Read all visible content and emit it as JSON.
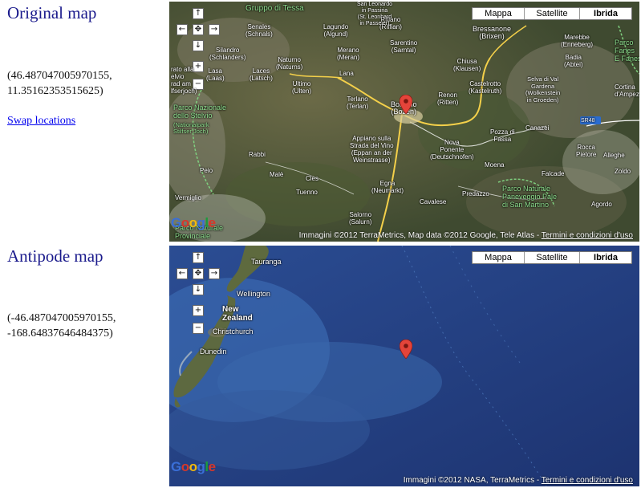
{
  "original": {
    "title": "Original map",
    "coords_line1": "(46.487047005970155,",
    "coords_line2": "11.35162353515625)",
    "swap_link": "Swap locations"
  },
  "antipode": {
    "title": "Antipode map",
    "coords_line1": "(-46.487047005970155,",
    "coords_line2": "-168.64837646484375)"
  },
  "map_controls": {
    "types": [
      "Mappa",
      "Satellite",
      "Ibrida"
    ],
    "selected": "Ibrida",
    "pan_up": "↑",
    "pan_left": "←",
    "pan_center": "✥",
    "pan_right": "→",
    "pan_down": "↓",
    "zoom_in": "+",
    "zoom_out": "−"
  },
  "original_map": {
    "labels": {
      "gruppo_tessa": "Gruppo di Tessa",
      "senales": "Senales\n(Schnals)",
      "lagundo": "Lagundo\n(Algund)",
      "rifiano": "Rifiano\n(Riffian)",
      "san_leonardo": "San Leonardo\nin Passiria\n(St. Leonhard\nin Passeier)",
      "sarentino": "Sarentino\n(Sarntal)",
      "bressanone": "Bressanone\n(Brixen)",
      "marebbe": "Marebbe\n(Enneberg)",
      "parco_fanes": "Parco\nFanes\nE Fanes",
      "silandro": "Silandro\n(Schlanders)",
      "naturno": "Naturno\n(Naturns)",
      "merano": "Merano\n(Meran)",
      "laces": "Laces\n(Latsch)",
      "lasa": "Lasa\n(Laas)",
      "prato": "rato alla\nelvio\nrad am\nlfserjoch)",
      "ultimo": "Ultimo\n(Ulten)",
      "lana": "Lana",
      "chiusa": "Chiusa\n(Klausen)",
      "badia": "Badia\n(Abtei)",
      "castelrotto": "Castelrotto\n(Kastelruth)",
      "selva": "Selva di Val\nGardena\n(Wolkenstein\nin Groeden)",
      "cortina": "Cortina\nd'Ampezz",
      "parco_stelvio": "Parco Nazionale\ndello Stelvio",
      "stelvio_sub": "(Nationalpark\nStilfser Joch)",
      "terlano": "Terlano\n(Terlan)",
      "bolzano": "Bolzano\n(Bozen)",
      "renon": "Renon\n(Ritten)",
      "sr48": "SR48",
      "appiano": "Appiano sulla\nStrada del Vino\n(Eppan an der\nWeinstrasse)",
      "nova_ponente": "Nova\nPonente\n(Deutschnofen)",
      "pozza": "Pozza di\nFassa",
      "canazei": "Canazei",
      "rabbi": "Rabbi",
      "rocca": "Rocca\nPietore",
      "alleghe": "Alleghe",
      "peio": "Peio",
      "male": "Malè",
      "cles": "Cles",
      "moena": "Moena",
      "falcade": "Falcade",
      "zoldo": "Zoldo",
      "vermiglio": "Vermiglio",
      "tuenno": "Tuenno",
      "egna": "Egna\n(Neumarkt)",
      "predazzo": "Predazzo",
      "parco_paneveggio": "Parco Naturale\nPaneveggio Pale\ndi San Martino",
      "cavalese": "Cavalese",
      "agordo": "Agordo",
      "salorno": "Salorno\n(Salurn)",
      "parco_adamello": "Parco Naturale\nProvinciale"
    },
    "attribution": "Immagini ©2012 TerraMetrics, Map data ©2012 Google, Tele Atlas -",
    "terms": "Termini e condizioni d'uso",
    "logo": "Google"
  },
  "antipode_map": {
    "labels": {
      "tauranga": "Tauranga",
      "wellington": "Wellington",
      "new_zealand": "New\nZealand",
      "christchurch": "Christchurch",
      "dunedin": "Dunedin"
    },
    "attribution": "Immagini ©2012 NASA, TerraMetrics -",
    "terms": "Termini e condizioni d'uso",
    "logo": "Google"
  },
  "colors": {
    "heading": "#1a1a8c",
    "link": "#0000ee",
    "terrain": "#4f5a3a",
    "ocean": "#1f3c78",
    "marker": "#e4443a"
  }
}
